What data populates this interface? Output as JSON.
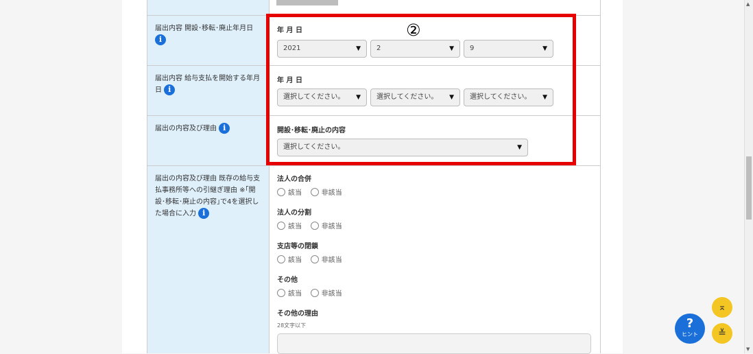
{
  "rows": {
    "est_date": {
      "label": "届出内容 開設･移転･廃止年月日",
      "field_label": "年 月 日",
      "year": "2021",
      "month": "2",
      "day": "9"
    },
    "pay_date": {
      "label": "届出内容 給与支払を開始する年月日",
      "field_label": "年 月 日",
      "year": "選択してください。",
      "month": "選択してください。",
      "day": "選択してください。"
    },
    "reason": {
      "label": "届出の内容及び理由",
      "field_label": "開設･移転･廃止の内容",
      "select": "選択してください。"
    },
    "succession": {
      "label": "届出の内容及び理由 既存の給与支払事務所等への引継ぎ理由 ※｢開設･移転･廃止の内容｣で4を選択した場合に入力",
      "groups": [
        {
          "title": "法人の合併",
          "opt1": "該当",
          "opt2": "非該当"
        },
        {
          "title": "法人の分割",
          "opt1": "該当",
          "opt2": "非該当"
        },
        {
          "title": "支店等の閉鎖",
          "opt1": "該当",
          "opt2": "非該当"
        },
        {
          "title": "その他",
          "opt1": "該当",
          "opt2": "非該当"
        }
      ],
      "other_reason_label": "その他の理由",
      "other_reason_hint": "28文字以下"
    }
  },
  "annotation": "②",
  "hint_button": {
    "symbol": "?",
    "label": "ヒント"
  },
  "icons": {
    "info": "info-icon",
    "scroll_top": "chevron-up-bar-icon",
    "scroll_bottom": "chevron-down-bar-icon"
  },
  "colors": {
    "accent": "#1a6fd8",
    "highlight": "#e60000",
    "header_bg": "#dff0fb",
    "fab": "#f3c623"
  }
}
